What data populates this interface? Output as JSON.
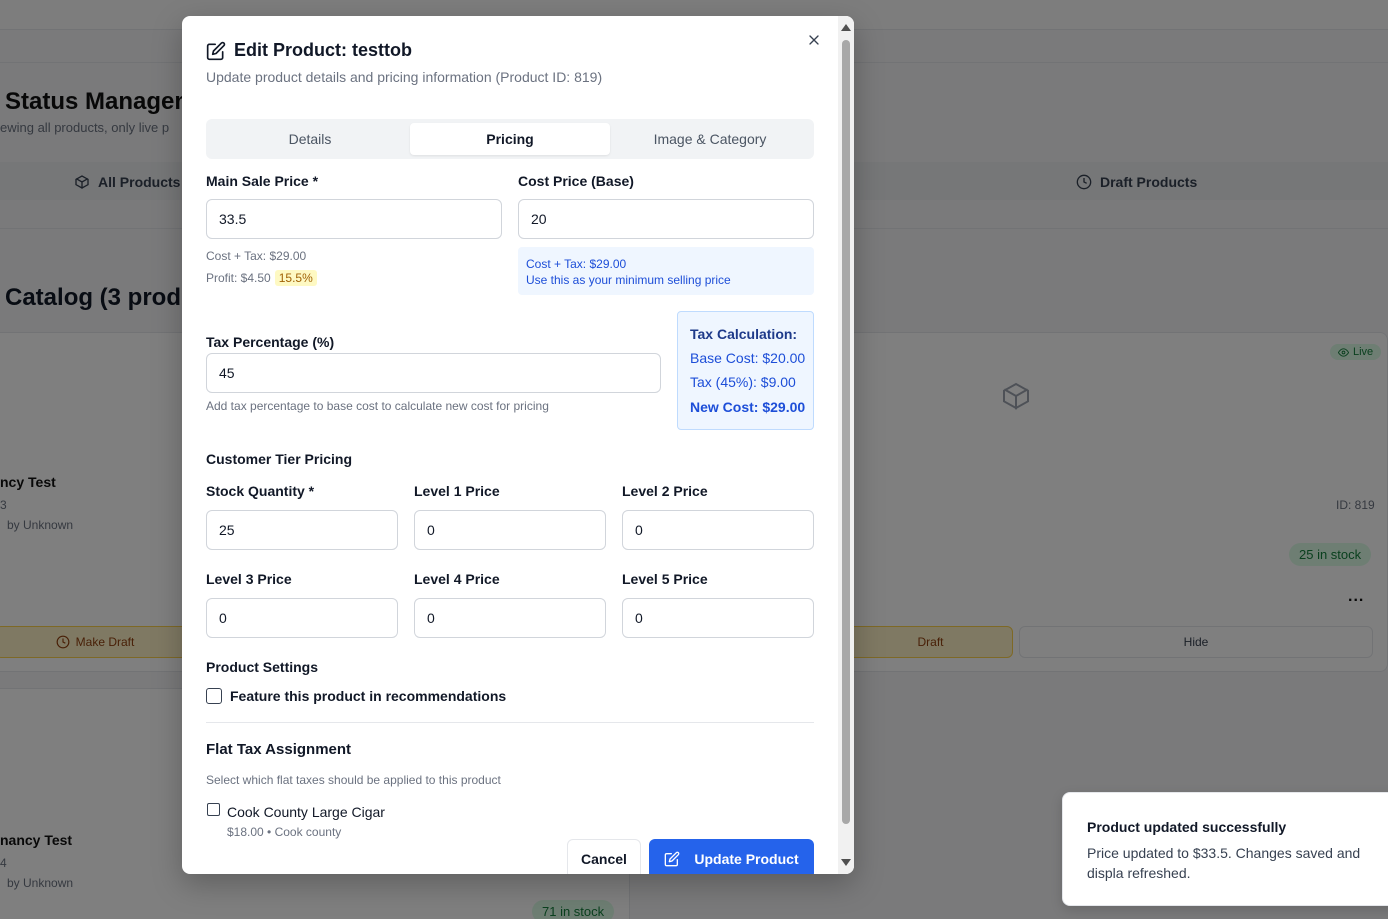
{
  "background": {
    "title": "Status Manageme",
    "subtitle": "ewing all products, only live p",
    "tab_all": "All Products (",
    "tab_draft": "Draft Products",
    "catalog_title": "Catalog (3 produ",
    "card1": {
      "name": "ncy Test",
      "id_fragment": "3",
      "by": "by Unknown"
    },
    "card2": {
      "name": "nancy Test",
      "id_fragment": "4",
      "by": "by Unknown"
    },
    "live_badge": "Live",
    "id_label": "ID: 819",
    "stock1": "25 in stock",
    "stock2": "71 in stock",
    "make_draft": "Make Draft",
    "draft_fragment": "Draft",
    "hide": "Hide",
    "more": "..."
  },
  "modal": {
    "title": "Edit Product: testtob",
    "description": "Update product details and pricing information (Product ID: 819)",
    "tabs": [
      {
        "label": "Details"
      },
      {
        "label": "Pricing"
      },
      {
        "label": "Image & Category"
      }
    ],
    "active_tab": "Pricing",
    "main_sale_price": {
      "label": "Main Sale Price *",
      "value": "33.5"
    },
    "cost_price": {
      "label": "Cost Price (Base)",
      "value": "20"
    },
    "cost_tax_hint": "Cost + Tax: $29.00",
    "profit_hint": "Profit: $4.50",
    "profit_pct": "15.5%",
    "cost_info": {
      "line1": "Cost + Tax: $29.00",
      "line2": "Use this as your minimum selling price"
    },
    "tax_percentage": {
      "label": "Tax Percentage (%)",
      "value": "45",
      "hint": "Add tax percentage to base cost to calculate new cost for pricing"
    },
    "tax_calc": {
      "title": "Tax Calculation:",
      "base_cost": "Base Cost: $20.00",
      "tax": "Tax (45%): $9.00",
      "new_cost": "New Cost: $29.00"
    },
    "tier_title": "Customer Tier Pricing",
    "stock_quantity": {
      "label": "Stock Quantity *",
      "value": "25"
    },
    "level1": {
      "label": "Level 1 Price",
      "value": "0"
    },
    "level2": {
      "label": "Level 2 Price",
      "value": "0"
    },
    "level3": {
      "label": "Level 3 Price",
      "value": "0"
    },
    "level4": {
      "label": "Level 4 Price",
      "value": "0"
    },
    "level5": {
      "label": "Level 5 Price",
      "value": "0"
    },
    "settings_title": "Product Settings",
    "feature_label": "Feature this product in recommendations",
    "flat_tax_title": "Flat Tax Assignment",
    "flat_tax_hint": "Select which flat taxes should be applied to this product",
    "flat_tax_item": {
      "name": "Cook County Large Cigar",
      "detail": "$18.00 • Cook county"
    },
    "cancel_label": "Cancel",
    "update_label": "Update Product"
  },
  "toast": {
    "title": "Product updated successfully",
    "body": "Price updated to $33.5. Changes saved and displa refreshed."
  }
}
